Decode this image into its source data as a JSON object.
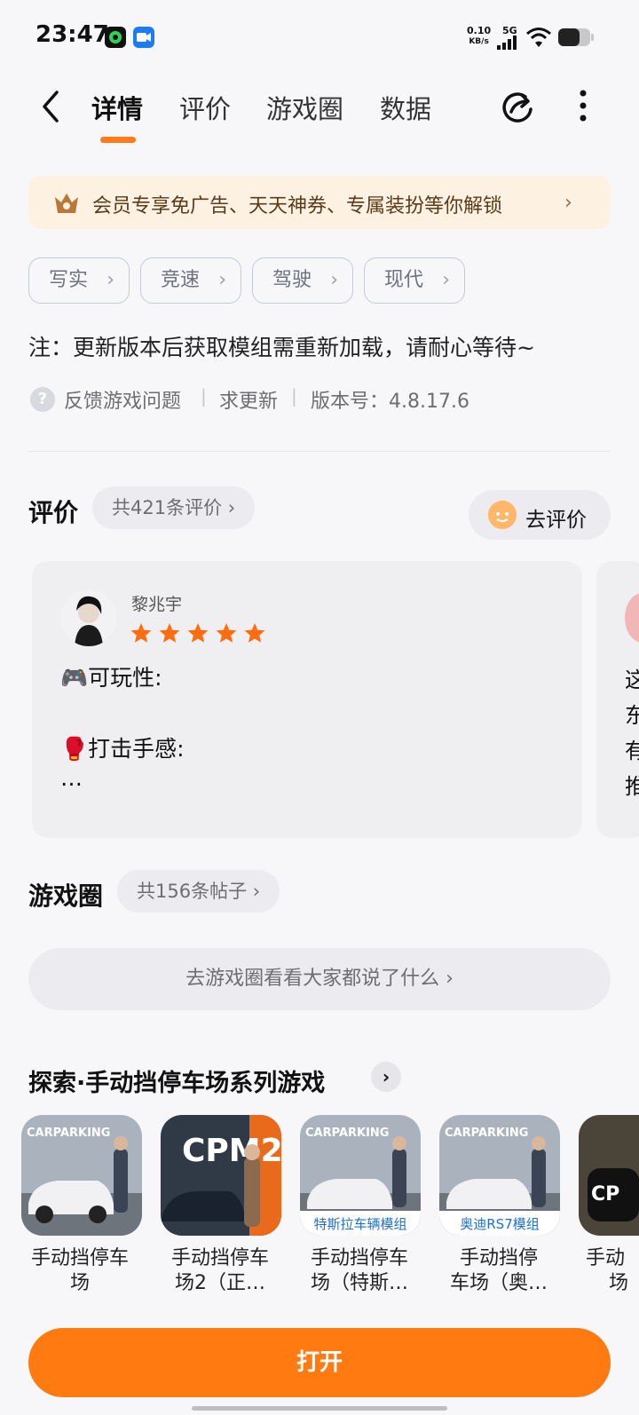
{
  "status_bar": {
    "time": "23:47",
    "net_speed_top": "0.10",
    "net_speed_bottom": "KB/s",
    "network": "5G"
  },
  "tabs": [
    {
      "label": "详情",
      "active": true
    },
    {
      "label": "评价",
      "active": false
    },
    {
      "label": "游戏圈",
      "active": false
    },
    {
      "label": "数据",
      "active": false
    }
  ],
  "member_banner": {
    "text": "会员专享免广告、天天神券、专属装扮等你解锁",
    "chevron": "›"
  },
  "tags": [
    {
      "label": "写实",
      "chevron": "›"
    },
    {
      "label": "竞速",
      "chevron": "›"
    },
    {
      "label": "驾驶",
      "chevron": "›"
    },
    {
      "label": "现代",
      "chevron": "›"
    }
  ],
  "note": "注：更新版本后获取模组需重新加载，请耐心等待~",
  "meta": {
    "help_icon": "?",
    "feedback": "反馈游戏问题",
    "request_update": "求更新",
    "version": "版本号：4.8.17.6",
    "separator": "|"
  },
  "reviews_section": {
    "title": "评价",
    "count": "共421条评价 ›",
    "go_review": "去评价",
    "card": {
      "user": "黎兆宇",
      "rating": 5,
      "line1": "🎮可玩性:",
      "line2": "🥊打击手感:",
      "line3": "…"
    },
    "peek_chars": [
      "这",
      "东",
      "有",
      "推"
    ]
  },
  "circle_section": {
    "title": "游戏圈",
    "count": "共156条帖子 ›",
    "button": "去游戏圈看看大家都说了什么 ›"
  },
  "explore": {
    "title": "探索·手动挡停车场系列游戏",
    "chevron": "›",
    "games": [
      {
        "name_line1": "手动挡停车",
        "name_line2": "场",
        "badge": "",
        "art_text": "CARPARKING"
      },
      {
        "name_line1": "手动挡停车",
        "name_line2": "场2（正…",
        "badge": "",
        "art_text": "CPM2"
      },
      {
        "name_line1": "手动挡停车",
        "name_line2": "场（特斯…",
        "badge": "特斯拉车辆模组",
        "art_text": "CARPARKING"
      },
      {
        "name_line1": "手动挡停",
        "name_line2": "车场（奥…",
        "badge": "奥迪RS7模组",
        "art_text": "CARPARKING"
      },
      {
        "name_line1": "手动",
        "name_line2": "场",
        "badge": "",
        "art_text": "CP"
      }
    ]
  },
  "bottom": {
    "open_button": "打开"
  },
  "colors": {
    "accent": "#ff7a10",
    "star": "#ff6d10",
    "banner_bg": "#fdf2e2"
  },
  "icons": [
    "back-arrow-icon",
    "share-icon",
    "more-vertical-icon",
    "crown-icon",
    "help-icon",
    "star-icon",
    "chevron-right-icon"
  ]
}
